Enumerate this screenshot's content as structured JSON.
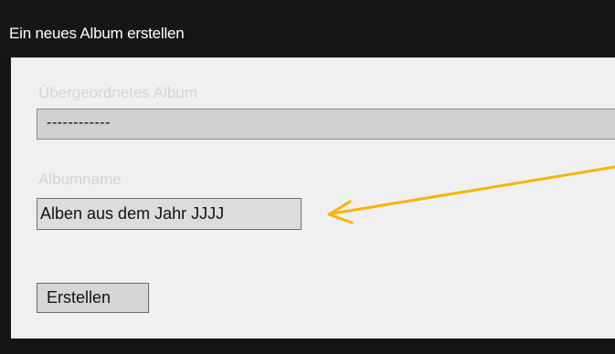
{
  "dialog": {
    "title": "Ein neues Album erstellen"
  },
  "form": {
    "parent_album_label": "Übergeordnetes Album",
    "parent_album_value": "------------",
    "album_name_label": "Albumname",
    "album_name_value": "Alben aus dem Jahr JJJJ",
    "create_button_label": "Erstellen"
  },
  "annotation": {
    "arrow_color": "#f5b500"
  }
}
